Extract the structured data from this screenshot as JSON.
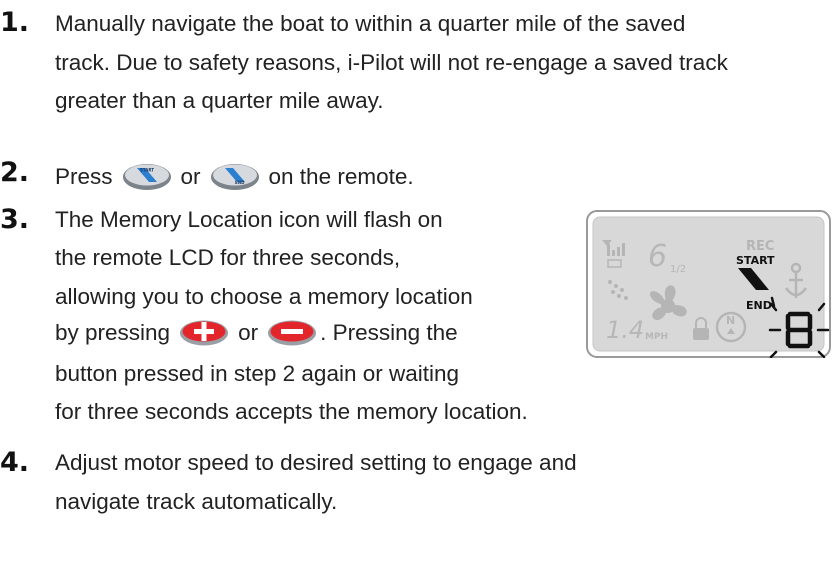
{
  "steps": [
    {
      "number": "1.",
      "lines": [
        "Manually navigate the boat to within a quarter mile of the saved",
        "track. Due to safety reasons, i-Pilot will not re-engage a saved track",
        "greater than a quarter mile away."
      ]
    },
    {
      "number": "2.",
      "before": "Press",
      "or": "or",
      "after": "on the remote."
    },
    {
      "number": "3.",
      "lines": [
        "The Memory Location icon will flash on",
        "the remote LCD for three seconds,",
        "allowing you to choose a memory location"
      ],
      "by": "by pressing",
      "or": "or",
      "pressing": ". Pressing the",
      "lines2": [
        "button pressed in step 2 again or waiting",
        "for three seconds accepts the memory location."
      ]
    },
    {
      "number": "4.",
      "lines": [
        "Adjust motor speed to desired setting to engage and",
        "navigate track automatically."
      ]
    }
  ],
  "buttons": {
    "start_label": "START",
    "end_label": "END"
  },
  "lcd": {
    "rec": "REC",
    "start": "START",
    "end": "END",
    "speed_num": "1.4",
    "speed_unit": "MPH",
    "top_num": "6",
    "fraction": "1/2",
    "compass": "N",
    "digit": "8"
  },
  "colors": {
    "button_blue": "#2a7fd0",
    "button_grey": "#8a8f96",
    "plus_red": "#e3262b",
    "minus_red": "#e3262b",
    "lcd_bg": "#d8d8d8",
    "lcd_border": "#9a9a9a"
  }
}
